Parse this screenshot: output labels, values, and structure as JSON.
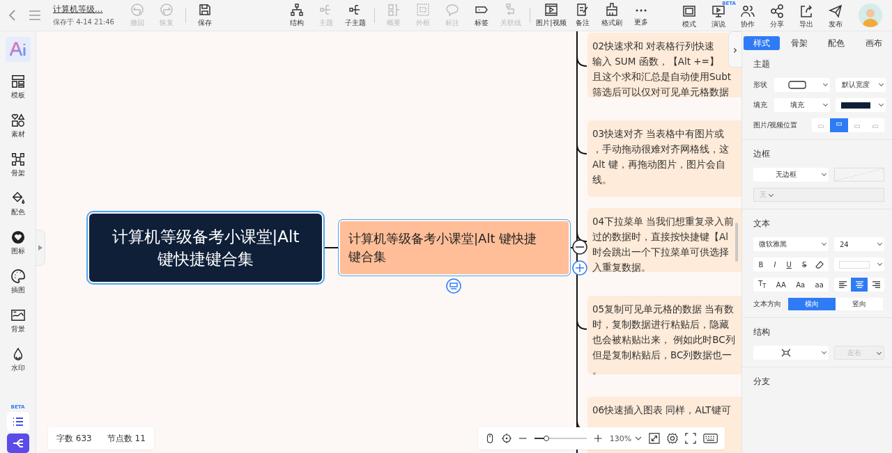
{
  "toolbar": {
    "title": "计算机等级...",
    "saved_at": "保存于 4-14 21:46",
    "edit_actions": [
      {
        "label": "撤回",
        "disabled": true,
        "divider_before": false
      },
      {
        "label": "恢复",
        "disabled": true,
        "divider_before": false
      },
      {
        "label": "保存",
        "disabled": false,
        "divider_before": true
      }
    ],
    "insert_actions": [
      {
        "label": "结构",
        "disabled": false,
        "divider_before": false
      },
      {
        "label": "主题",
        "disabled": true,
        "divider_before": false
      },
      {
        "label": "子主题",
        "disabled": false,
        "divider_before": false
      },
      {
        "label": "概要",
        "disabled": true,
        "divider_before": true
      },
      {
        "label": "外框",
        "disabled": true,
        "divider_before": false
      },
      {
        "label": "标注",
        "disabled": true,
        "divider_before": false
      },
      {
        "label": "标签",
        "disabled": false,
        "divider_before": false
      },
      {
        "label": "关联线",
        "disabled": true,
        "divider_before": false
      },
      {
        "label": "图片|视频",
        "disabled": false,
        "divider_before": true
      },
      {
        "label": "备注",
        "disabled": false,
        "divider_before": false
      },
      {
        "label": "格式刷",
        "disabled": false,
        "divider_before": false
      },
      {
        "label": "更多",
        "disabled": false,
        "divider_before": false
      }
    ],
    "right_actions": [
      {
        "label": "模式"
      },
      {
        "label": "演说",
        "badge": "BETA"
      },
      {
        "label": "协作"
      },
      {
        "label": "分享"
      },
      {
        "label": "导出"
      },
      {
        "label": "发布"
      }
    ]
  },
  "sidebar": {
    "items": [
      {
        "label": "模板"
      },
      {
        "label": "素材"
      },
      {
        "label": "骨架"
      },
      {
        "label": "配色"
      },
      {
        "label": "图标"
      },
      {
        "label": "插图"
      },
      {
        "label": "背景"
      },
      {
        "label": "水印"
      }
    ],
    "beta": "BETA",
    "views": [
      {
        "selected": false
      },
      {
        "selected": true
      }
    ]
  },
  "canvas": {
    "root": {
      "lines": [
        "计算机等级备考小课堂|Alt",
        "键快捷键合集"
      ]
    },
    "branch": {
      "lines": [
        "计算机等级备考小课堂|Alt 键快捷",
        "键合集"
      ]
    },
    "children": [
      {
        "lines": [
          "02快速求和 对表格行列快速",
          "输入 SUM 函数，【Alt +=】",
          "且这个求和汇总是自动使用Subt",
          "筛选后可以仅对可见单元格数据"
        ]
      },
      {
        "lines": [
          "03快速对齐 当表格中有图片或",
          "，手动拖动很难对齐网格线，这",
          "Alt 键，再拖动图片，图片会自",
          "线。"
        ]
      },
      {
        "lines": [
          "04下拉菜单 当我们想重复录入前",
          "过的数据时，直接按快捷键【Al",
          "时会跳出一个下拉菜单可供选择",
          "入重复数据。"
        ]
      },
      {
        "lines": [
          "05复制可见单元格的数据 当有数",
          "时，复制数据进行粘贴后，隐藏",
          "也会被粘贴出来， 例如此时BC列",
          "但是复制粘贴后，BC列数据也一",
          "。"
        ]
      },
      {
        "lines": [
          "06快速插入图表 同样，ALT键可"
        ]
      }
    ],
    "collapse": "›",
    "stats": [
      "字数 633",
      "节点数 11"
    ],
    "zoom": {
      "level": 0.23,
      "value": "130%"
    }
  },
  "panel": {
    "tabs": [
      {
        "label": "样式",
        "selected": true
      },
      {
        "label": "骨架",
        "selected": false
      },
      {
        "label": "配色",
        "selected": false
      },
      {
        "label": "画布",
        "selected": false
      }
    ],
    "theme": {
      "heading": "主题",
      "shape_label": "形状",
      "width_value": "默认宽度",
      "fill_label": "填充",
      "fill_value": "填充",
      "media_label": "图片/视频位置",
      "media_positions": [
        {
          "selected": false
        },
        {
          "selected": true
        },
        {
          "selected": false
        },
        {
          "selected": false
        }
      ]
    },
    "border": {
      "heading": "边框",
      "style_value": "无边框",
      "width_value": "无"
    },
    "text": {
      "heading": "文本",
      "font_value": "微软雅黑",
      "size_value": "24",
      "format_buttons": [
        "B",
        "I",
        "U",
        "S"
      ],
      "case_buttons": [
        "T$_{T}$",
        "AA",
        "Aa",
        "aa"
      ],
      "align": [
        {
          "selected": false
        },
        {
          "selected": true
        },
        {
          "selected": false
        }
      ],
      "direction_label": "文本方向",
      "directions": [
        {
          "label": "横向",
          "selected": true
        },
        {
          "label": "竖向",
          "selected": false
        }
      ]
    },
    "structure": {
      "heading": "结构",
      "layout_value": "左右",
      "layout_disabled": true
    },
    "branch": {
      "heading": "分支"
    }
  }
}
